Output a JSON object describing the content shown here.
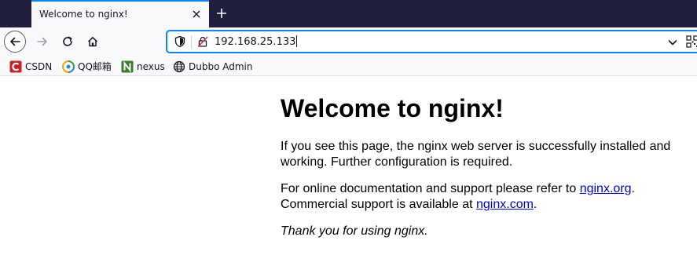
{
  "tab": {
    "title": "Welcome to nginx!"
  },
  "urlbar": {
    "url": "192.168.25.133"
  },
  "bookmarks": [
    {
      "label": "CSDN",
      "icon": "csdn-icon"
    },
    {
      "label": "QQ邮箱",
      "icon": "qq-mail-icon"
    },
    {
      "label": "nexus",
      "icon": "nexus-icon"
    },
    {
      "label": "Dubbo Admin",
      "icon": "globe-icon"
    }
  ],
  "page": {
    "heading": "Welcome to nginx!",
    "p1": "If you see this page, the nginx web server is successfully installed and working. Further configuration is required.",
    "p2_before": "For online documentation and support please refer to ",
    "link1": "nginx.org",
    "p2_mid": ".",
    "p2_line2": "Commercial support is available at ",
    "link2": "nginx.com",
    "p2_end": ".",
    "p3": "Thank you for using nginx."
  },
  "colors": {
    "tabbar_bg": "#1f1e3d",
    "accent": "#0a84ff",
    "link": "#0000ee"
  }
}
